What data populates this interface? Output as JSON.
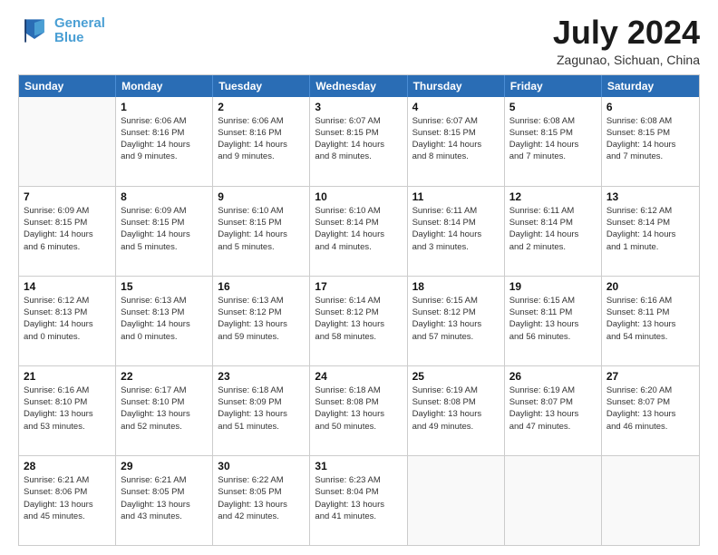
{
  "logo": {
    "line1": "General",
    "line2": "Blue"
  },
  "title": "July 2024",
  "subtitle": "Zagunao, Sichuan, China",
  "header_days": [
    "Sunday",
    "Monday",
    "Tuesday",
    "Wednesday",
    "Thursday",
    "Friday",
    "Saturday"
  ],
  "weeks": [
    [
      {
        "day": "",
        "info": ""
      },
      {
        "day": "1",
        "info": "Sunrise: 6:06 AM\nSunset: 8:16 PM\nDaylight: 14 hours\nand 9 minutes."
      },
      {
        "day": "2",
        "info": "Sunrise: 6:06 AM\nSunset: 8:16 PM\nDaylight: 14 hours\nand 9 minutes."
      },
      {
        "day": "3",
        "info": "Sunrise: 6:07 AM\nSunset: 8:15 PM\nDaylight: 14 hours\nand 8 minutes."
      },
      {
        "day": "4",
        "info": "Sunrise: 6:07 AM\nSunset: 8:15 PM\nDaylight: 14 hours\nand 8 minutes."
      },
      {
        "day": "5",
        "info": "Sunrise: 6:08 AM\nSunset: 8:15 PM\nDaylight: 14 hours\nand 7 minutes."
      },
      {
        "day": "6",
        "info": "Sunrise: 6:08 AM\nSunset: 8:15 PM\nDaylight: 14 hours\nand 7 minutes."
      }
    ],
    [
      {
        "day": "7",
        "info": "Sunrise: 6:09 AM\nSunset: 8:15 PM\nDaylight: 14 hours\nand 6 minutes."
      },
      {
        "day": "8",
        "info": "Sunrise: 6:09 AM\nSunset: 8:15 PM\nDaylight: 14 hours\nand 5 minutes."
      },
      {
        "day": "9",
        "info": "Sunrise: 6:10 AM\nSunset: 8:15 PM\nDaylight: 14 hours\nand 5 minutes."
      },
      {
        "day": "10",
        "info": "Sunrise: 6:10 AM\nSunset: 8:14 PM\nDaylight: 14 hours\nand 4 minutes."
      },
      {
        "day": "11",
        "info": "Sunrise: 6:11 AM\nSunset: 8:14 PM\nDaylight: 14 hours\nand 3 minutes."
      },
      {
        "day": "12",
        "info": "Sunrise: 6:11 AM\nSunset: 8:14 PM\nDaylight: 14 hours\nand 2 minutes."
      },
      {
        "day": "13",
        "info": "Sunrise: 6:12 AM\nSunset: 8:14 PM\nDaylight: 14 hours\nand 1 minute."
      }
    ],
    [
      {
        "day": "14",
        "info": "Sunrise: 6:12 AM\nSunset: 8:13 PM\nDaylight: 14 hours\nand 0 minutes."
      },
      {
        "day": "15",
        "info": "Sunrise: 6:13 AM\nSunset: 8:13 PM\nDaylight: 14 hours\nand 0 minutes."
      },
      {
        "day": "16",
        "info": "Sunrise: 6:13 AM\nSunset: 8:12 PM\nDaylight: 13 hours\nand 59 minutes."
      },
      {
        "day": "17",
        "info": "Sunrise: 6:14 AM\nSunset: 8:12 PM\nDaylight: 13 hours\nand 58 minutes."
      },
      {
        "day": "18",
        "info": "Sunrise: 6:15 AM\nSunset: 8:12 PM\nDaylight: 13 hours\nand 57 minutes."
      },
      {
        "day": "19",
        "info": "Sunrise: 6:15 AM\nSunset: 8:11 PM\nDaylight: 13 hours\nand 56 minutes."
      },
      {
        "day": "20",
        "info": "Sunrise: 6:16 AM\nSunset: 8:11 PM\nDaylight: 13 hours\nand 54 minutes."
      }
    ],
    [
      {
        "day": "21",
        "info": "Sunrise: 6:16 AM\nSunset: 8:10 PM\nDaylight: 13 hours\nand 53 minutes."
      },
      {
        "day": "22",
        "info": "Sunrise: 6:17 AM\nSunset: 8:10 PM\nDaylight: 13 hours\nand 52 minutes."
      },
      {
        "day": "23",
        "info": "Sunrise: 6:18 AM\nSunset: 8:09 PM\nDaylight: 13 hours\nand 51 minutes."
      },
      {
        "day": "24",
        "info": "Sunrise: 6:18 AM\nSunset: 8:08 PM\nDaylight: 13 hours\nand 50 minutes."
      },
      {
        "day": "25",
        "info": "Sunrise: 6:19 AM\nSunset: 8:08 PM\nDaylight: 13 hours\nand 49 minutes."
      },
      {
        "day": "26",
        "info": "Sunrise: 6:19 AM\nSunset: 8:07 PM\nDaylight: 13 hours\nand 47 minutes."
      },
      {
        "day": "27",
        "info": "Sunrise: 6:20 AM\nSunset: 8:07 PM\nDaylight: 13 hours\nand 46 minutes."
      }
    ],
    [
      {
        "day": "28",
        "info": "Sunrise: 6:21 AM\nSunset: 8:06 PM\nDaylight: 13 hours\nand 45 minutes."
      },
      {
        "day": "29",
        "info": "Sunrise: 6:21 AM\nSunset: 8:05 PM\nDaylight: 13 hours\nand 43 minutes."
      },
      {
        "day": "30",
        "info": "Sunrise: 6:22 AM\nSunset: 8:05 PM\nDaylight: 13 hours\nand 42 minutes."
      },
      {
        "day": "31",
        "info": "Sunrise: 6:23 AM\nSunset: 8:04 PM\nDaylight: 13 hours\nand 41 minutes."
      },
      {
        "day": "",
        "info": ""
      },
      {
        "day": "",
        "info": ""
      },
      {
        "day": "",
        "info": ""
      }
    ]
  ]
}
